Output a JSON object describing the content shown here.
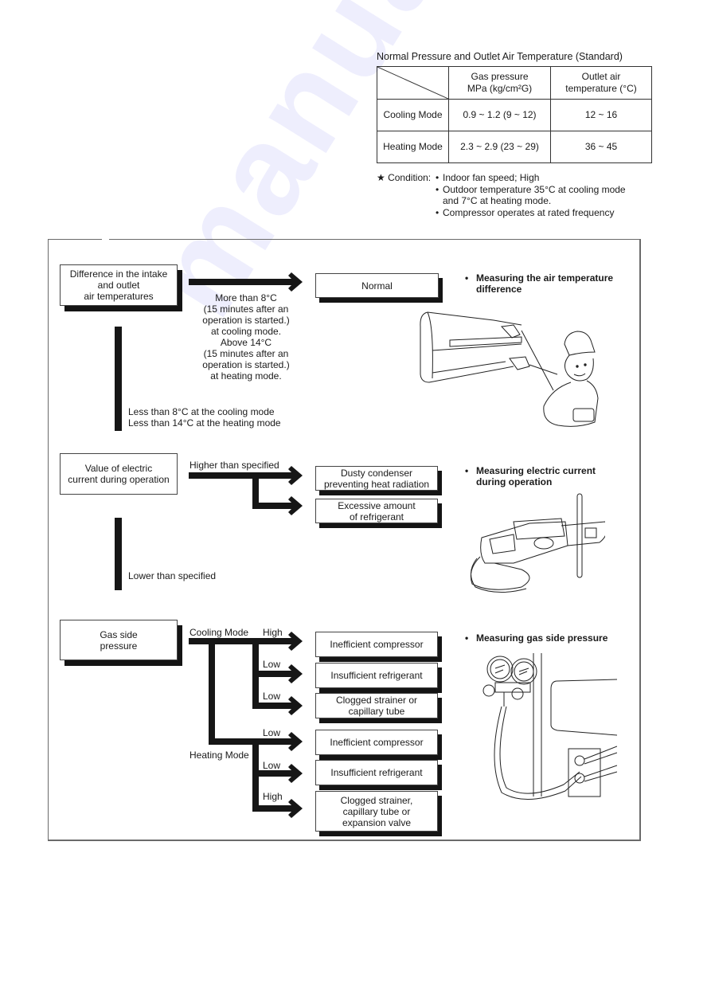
{
  "table": {
    "title": "Normal Pressure and Outlet Air Temperature (Standard)",
    "headers": {
      "gas_pressure": [
        "Gas pressure",
        "MPa (kg/cm²G)"
      ],
      "outlet_air": [
        "Outlet air",
        "temperature (°C)"
      ]
    },
    "rows": [
      {
        "mode": "Cooling Mode",
        "gas_pressure": "0.9 ~ 1.2 (9 ~ 12)",
        "outlet_temp": "12 ~ 16"
      },
      {
        "mode": "Heating Mode",
        "gas_pressure": "2.3 ~ 2.9 (23 ~ 29)",
        "outlet_temp": "36 ~ 45"
      }
    ]
  },
  "condition": {
    "lead": "★ Condition:",
    "items": [
      "Indoor fan speed; High",
      "Outdoor temperature 35°C at cooling mode and 7°C at heating mode.",
      "Compressor operates at rated frequency"
    ]
  },
  "flow": {
    "section1": {
      "check_box": [
        "Difference in the intake",
        "and outlet",
        "air temperatures"
      ],
      "arrow_label": [
        "More than 8°C",
        "(15 minutes after an",
        "operation is started.)",
        "at cooling mode.",
        "Above 14°C",
        "(15 minutes after an",
        "operation is started.)",
        "at heating mode."
      ],
      "result": "Normal",
      "down_label": [
        "Less than 8°C at the cooling mode",
        "Less than 14°C at the heating mode"
      ],
      "illustration_title": [
        "Measuring the air temperature",
        "difference"
      ]
    },
    "section2": {
      "check_box": [
        "Value of electric",
        "current during operation"
      ],
      "arrow_label": "Higher than specified",
      "results": [
        [
          "Dusty condenser",
          "preventing heat radiation"
        ],
        [
          "Excessive amount",
          "of refrigerant"
        ]
      ],
      "down_label": "Lower than specified",
      "illustration_title": [
        "Measuring electric current",
        "during operation"
      ]
    },
    "section3": {
      "check_box": [
        "Gas side",
        "pressure"
      ],
      "cooling_label": "Cooling Mode",
      "heating_label": "Heating Mode",
      "cooling_branches": [
        {
          "level": "High",
          "result": [
            "Inefficient compressor"
          ]
        },
        {
          "level": "Low",
          "result": [
            "Insufficient refrigerant"
          ]
        },
        {
          "level": "Low",
          "result": [
            "Clogged strainer or",
            "capillary tube"
          ]
        }
      ],
      "heating_branches": [
        {
          "level": "Low",
          "result": [
            "Inefficient compressor"
          ]
        },
        {
          "level": "Low",
          "result": [
            "Insufficient refrigerant"
          ]
        },
        {
          "level": "High",
          "result": [
            "Clogged strainer,",
            "capillary tube or",
            "expansion valve"
          ]
        }
      ],
      "illustration_title": "Measuring gas side pressure"
    },
    "bullet": "•"
  },
  "watermark": "manualshive.com"
}
